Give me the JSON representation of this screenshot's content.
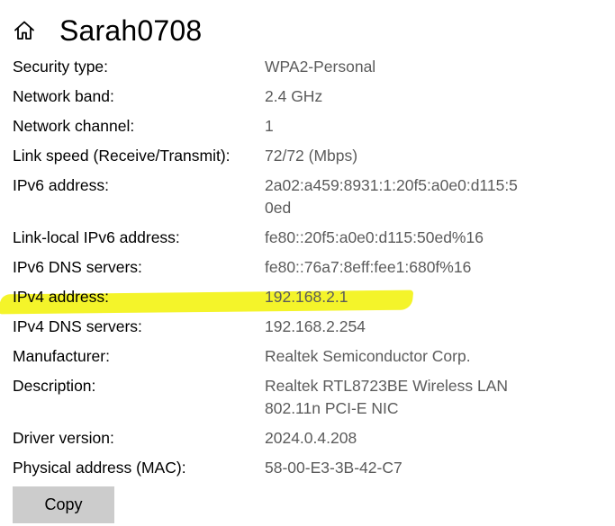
{
  "header": {
    "title": "Sarah0708",
    "icon": "home-icon"
  },
  "properties": [
    {
      "label": "Security type:",
      "value": "WPA2-Personal"
    },
    {
      "label": "Network band:",
      "value": "2.4 GHz"
    },
    {
      "label": "Network channel:",
      "value": "1"
    },
    {
      "label": "Link speed (Receive/Transmit):",
      "value": "72/72 (Mbps)"
    },
    {
      "label": "IPv6 address:",
      "value": "2a02:a459:8931:1:20f5:a0e0:d115:50ed"
    },
    {
      "label": "Link-local IPv6 address:",
      "value": "fe80::20f5:a0e0:d115:50ed%16"
    },
    {
      "label": "IPv6 DNS servers:",
      "value": "fe80::76a7:8eff:fee1:680f%16"
    },
    {
      "label": "IPv4 address:",
      "value": "192.168.2.1"
    },
    {
      "label": "IPv4 DNS servers:",
      "value": "192.168.2.254"
    },
    {
      "label": "Manufacturer:",
      "value": "Realtek Semiconductor Corp."
    },
    {
      "label": "Description:",
      "value": "Realtek RTL8723BE Wireless LAN 802.11n PCI-E NIC"
    },
    {
      "label": "Driver version:",
      "value": "2024.0.4.208"
    },
    {
      "label": "Physical address (MAC):",
      "value": "58-00-E3-3B-42-C7"
    }
  ],
  "highlight_color": "#f4f42a",
  "copy_button": {
    "label": "Copy"
  }
}
